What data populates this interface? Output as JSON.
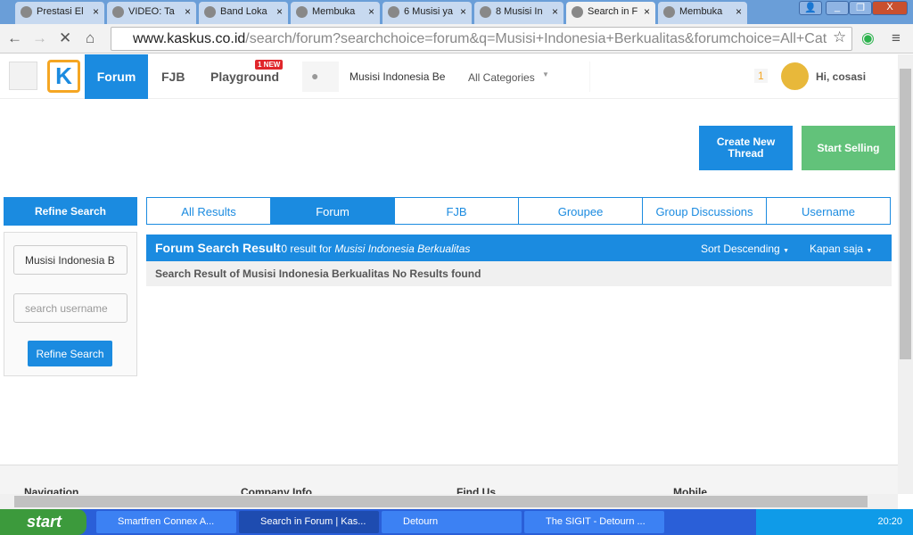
{
  "browser": {
    "tabs": [
      "Prestasi El",
      "VIDEO: Ta",
      "Band Loka",
      "Membuka",
      "6 Musisi ya",
      "8 Musisi In",
      "Search in F",
      "Membuka"
    ],
    "active_tab": 6,
    "url_host": "www.kaskus.co.id",
    "url_path": "/search/forum?searchchoice=forum&q=Musisi+Indonesia+Berkualitas&forumchoice=All+Cat"
  },
  "header": {
    "nav": [
      "Forum",
      "FJB",
      "Playground"
    ],
    "new_badge": "1 NEW",
    "search_value": "Musisi Indonesia Be",
    "category": "All Categories",
    "notif_count": "1",
    "greeting": "Hi, cosasi"
  },
  "actions": {
    "create": "Create New Thread",
    "sell": "Start Selling"
  },
  "sidebar": {
    "title": "Refine Search",
    "keyword": "Musisi Indonesia B",
    "username_placeholder": "search username",
    "button": "Refine Search"
  },
  "tabs": [
    "All Results",
    "Forum",
    "FJB",
    "Groupee",
    "Group Discussions",
    "Username"
  ],
  "result": {
    "title": "Forum Search Result",
    "count": " - 0 result for ",
    "query": "Musisi Indonesia Berkualitas",
    "sort": "Sort Descending",
    "time": "Kapan saja",
    "message": "Search Result of Musisi Indonesia Berkualitas No Results found"
  },
  "footer": [
    "Navigation",
    "Company Info",
    "Find Us",
    "Mobile"
  ],
  "taskbar": {
    "start": "start",
    "items": [
      "Smartfren Connex A...",
      "Search in Forum | Kas...",
      "Detourn",
      "The SIGIT - Detourn ..."
    ],
    "clock": "20:20"
  },
  "colors": {
    "brand": "#1b8be0",
    "sell": "#62c27a"
  }
}
